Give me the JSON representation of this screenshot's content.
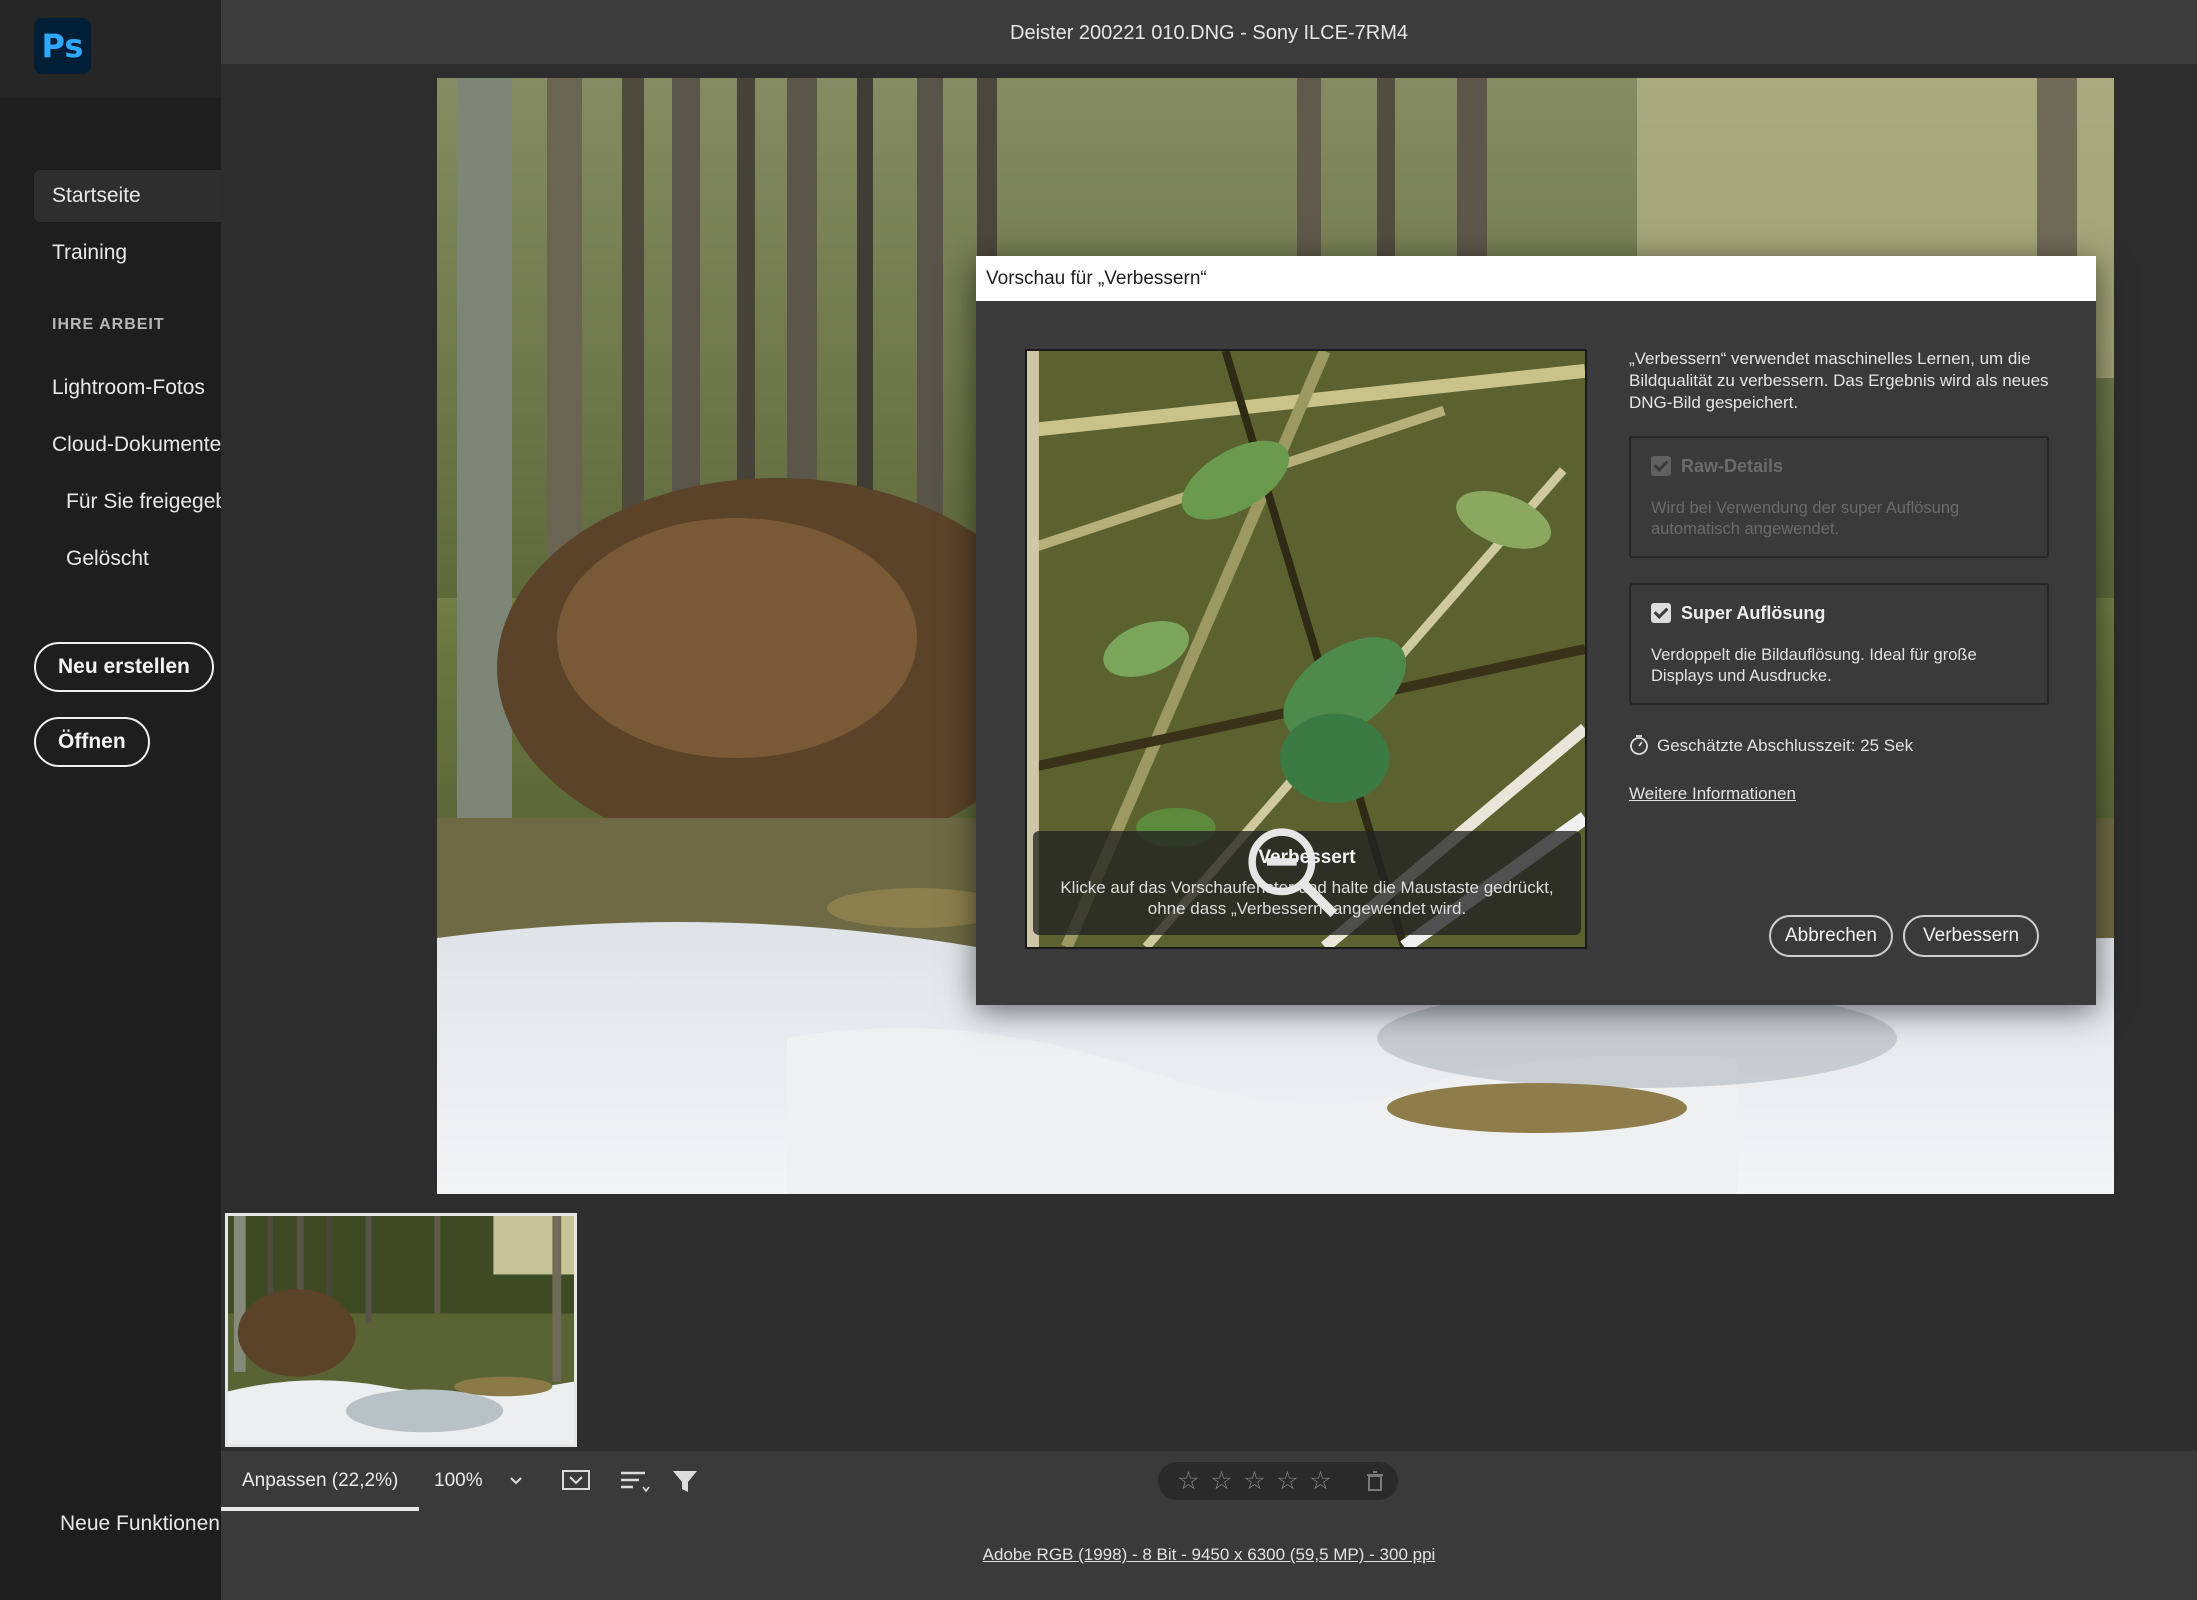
{
  "app": {
    "logo_text": "Ps"
  },
  "window": {
    "title": "Deister 200221 010.DNG - Sony ILCE-7RM4"
  },
  "sidebar": {
    "items": [
      {
        "label": "Startseite",
        "active": true
      },
      {
        "label": "Training"
      }
    ],
    "section_heading": "IHRE ARBEIT",
    "work_items": [
      {
        "label": "Lightroom-Fotos"
      },
      {
        "label": "Cloud-Dokumente"
      },
      {
        "label": "Für Sie freigegeben"
      },
      {
        "label": "Gelöscht"
      }
    ],
    "new_button": "Neu erstellen",
    "open_button": "Öffnen",
    "new_features": "Neue Funktionen"
  },
  "dialog": {
    "title": "Vorschau für „Verbessern“",
    "description": "„Verbessern“ verwendet maschinelles Lernen, um die Bildqualität zu verbessern. Das Ergebnis wird als neues DNG-Bild gespeichert.",
    "preview_caption_title": "Verbessert",
    "preview_caption_text": "Klicke auf das Vorschaufenster und halte die Maustaste gedrückt, ohne dass „Verbessern“ angewendet wird.",
    "options": [
      {
        "label": "Raw-Details",
        "checked": true,
        "enabled": false,
        "description": "Wird bei Verwendung der super Auflösung automatisch angewendet."
      },
      {
        "label": "Super Auflösung",
        "checked": true,
        "enabled": true,
        "description": "Verdoppelt die Bildauflösung. Ideal für große Displays und Ausdrucke."
      }
    ],
    "estimated_time": "Geschätzte Abschlusszeit: 25 Sek",
    "more_info": "Weitere Informationen",
    "cancel_button": "Abbrechen",
    "confirm_button": "Verbessern"
  },
  "toolbar": {
    "zoom_fit": "Anpassen (22,2%)",
    "zoom_percent": "100%",
    "rating_stars": [
      "☆",
      "☆",
      "☆",
      "☆",
      "☆"
    ]
  },
  "status": {
    "file_info": "Adobe RGB (1998) - 8 Bit - 9450 x 6300 (59,5 MP) - 300 ppi"
  },
  "colors": {
    "sidebar_bg": "#1e1e1e",
    "workspace_bg": "#2d2d2d",
    "panel_bg": "#3a3a3a",
    "ps_logo_bg": "#001e36",
    "ps_logo_fg": "#31a8ff"
  }
}
